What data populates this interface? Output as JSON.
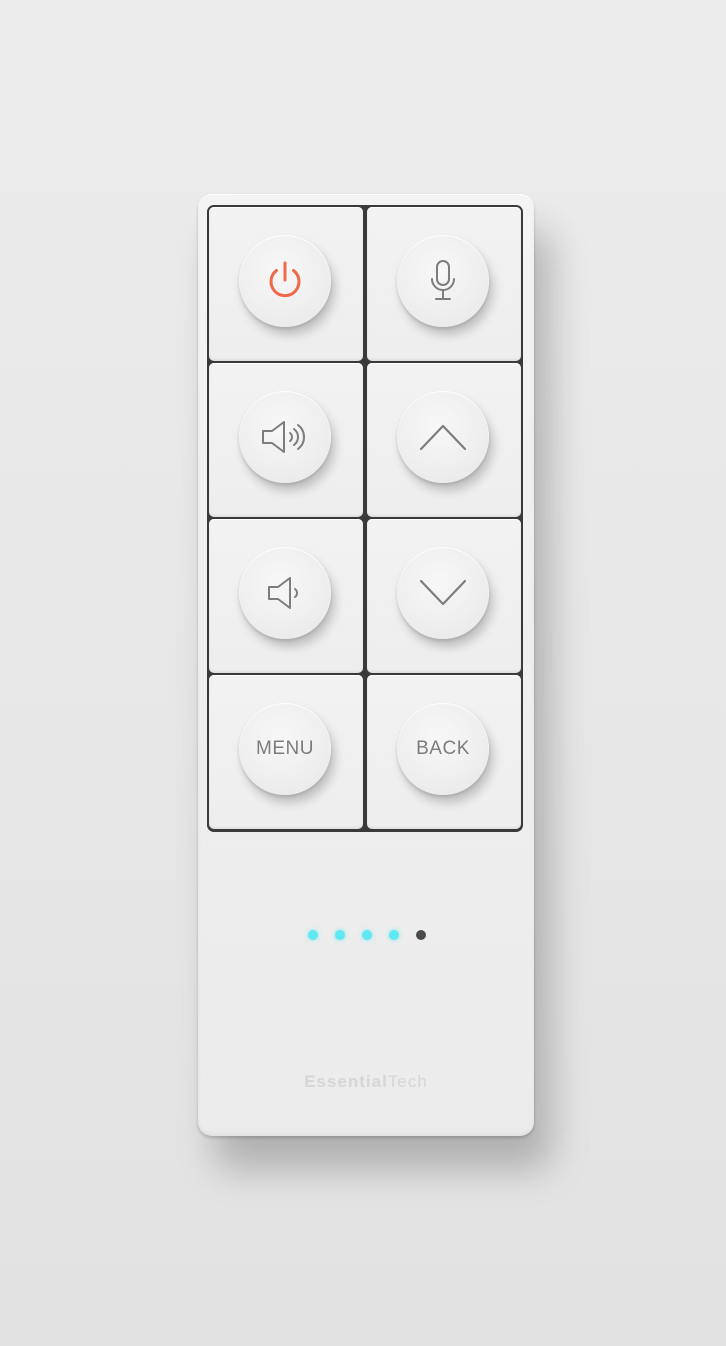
{
  "remote": {
    "buttons": [
      {
        "id": "power",
        "icon": "power-icon",
        "label": ""
      },
      {
        "id": "mic",
        "icon": "microphone-icon",
        "label": ""
      },
      {
        "id": "volume-up",
        "icon": "volume-up-icon",
        "label": ""
      },
      {
        "id": "up",
        "icon": "chevron-up-icon",
        "label": ""
      },
      {
        "id": "volume-down",
        "icon": "volume-down-icon",
        "label": ""
      },
      {
        "id": "down",
        "icon": "chevron-down-icon",
        "label": ""
      },
      {
        "id": "menu",
        "icon": "",
        "label": "MENU"
      },
      {
        "id": "back",
        "icon": "",
        "label": "BACK"
      }
    ],
    "menu_label": "MENU",
    "back_label": "BACK",
    "indicator": {
      "total": 5,
      "lit": 4,
      "lit_color": "#5ee8f2",
      "unlit_color": "#4a4a4a"
    },
    "brand": {
      "bold": "Essential",
      "regular": "Tech"
    },
    "colors": {
      "power_accent": "#f0694a",
      "icon_gray": "#7d7d7d",
      "body": "#f0f0f0",
      "keypad_gap": "#3a3a3a"
    }
  }
}
